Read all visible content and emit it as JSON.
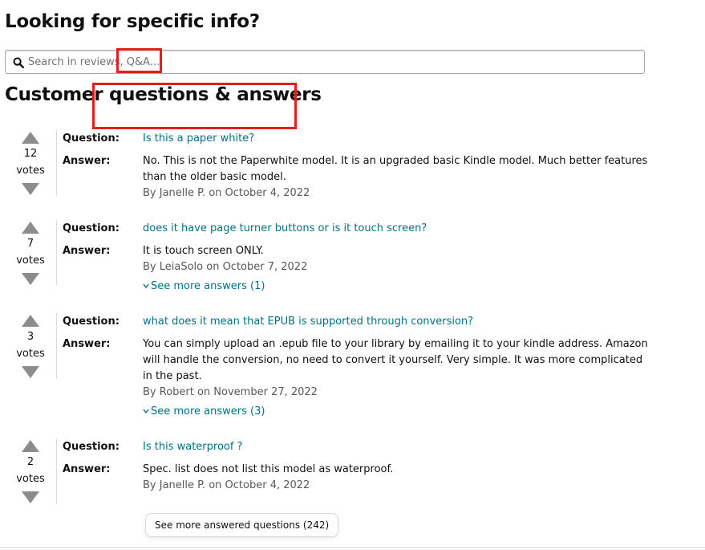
{
  "page": {
    "title": "Looking for specific info?",
    "section_title": "Customer questions & answers"
  },
  "search": {
    "placeholder": "Search in reviews, Q&A...",
    "icon": "search-icon"
  },
  "labels": {
    "question": "Question:",
    "answer": "Answer:",
    "votes": "votes"
  },
  "qa": [
    {
      "votes": "12",
      "question": "Is this a paper white?",
      "answer": "No. This is not the Paperwhite model. It is an upgraded basic Kindle model. Much better features than the older basic model.",
      "byline": "By Janelle P. on October 4, 2022",
      "more": ""
    },
    {
      "votes": "7",
      "question": "does it have page turner buttons or is it touch screen?",
      "answer": "It is touch screen ONLY.",
      "byline": "By LeiaSolo on October 7, 2022",
      "more": "See more answers (1)"
    },
    {
      "votes": "3",
      "question": "what does it mean that EPUB is supported through conversion?",
      "answer": "You can simply upload an .epub file to your library by emailing it to your kindle address. Amazon will handle the conversion, no need to convert it yourself. Very simple. It was more complicated in the past.",
      "byline": "By Robert on November 27, 2022",
      "more": "See more answers (3)"
    },
    {
      "votes": "2",
      "question": "Is this waterproof ?",
      "answer": "Spec. list does not list this model as waterproof.",
      "byline": "By Janelle P. on October 4, 2022",
      "more": ""
    }
  ],
  "see_more_questions": "See more answered questions (242)",
  "colors": {
    "link": "#007185",
    "highlight": "#e31e1e",
    "vote_arrow": "#8c8c8c",
    "muted_text": "#565959"
  }
}
